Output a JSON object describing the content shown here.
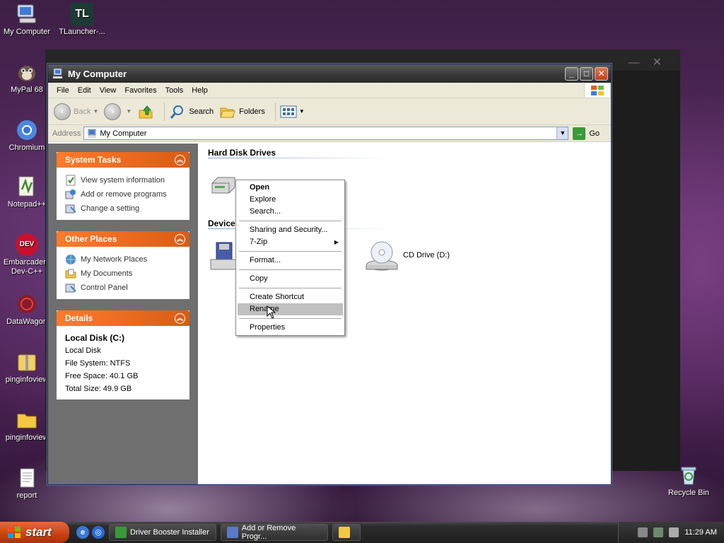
{
  "desktop": {
    "icons": [
      {
        "label": "My Computer"
      },
      {
        "label": "TLauncher-..."
      },
      {
        "label": "MyPal 68"
      },
      {
        "label": "Chromium"
      },
      {
        "label": "Notepad++"
      },
      {
        "label": "Embarcadero Dev-C++"
      },
      {
        "label": "DataWagon"
      },
      {
        "label": "pinginfoview"
      },
      {
        "label": "pinginfoview"
      },
      {
        "label": "report"
      },
      {
        "label": "Recycle Bin"
      }
    ],
    "tl_glyph": "TL",
    "dev_glyph": "DEV"
  },
  "window": {
    "title": "My Computer",
    "menu": [
      "File",
      "Edit",
      "View",
      "Favorites",
      "Tools",
      "Help"
    ],
    "toolbar": {
      "back": "Back",
      "search": "Search",
      "folders": "Folders"
    },
    "address": {
      "label": "Address",
      "value": "My Computer",
      "go": "Go"
    }
  },
  "sidebar": {
    "system_tasks": {
      "title": "System Tasks",
      "items": [
        "View system information",
        "Add or remove programs",
        "Change a setting"
      ]
    },
    "other_places": {
      "title": "Other Places",
      "items": [
        "My Network Places",
        "My Documents",
        "Control Panel"
      ]
    },
    "details": {
      "title": "Details",
      "name": "Local Disk (C:)",
      "type": "Local Disk",
      "file_system": "File System: NTFS",
      "free_space": "Free Space: 40.1 GB",
      "total_size": "Total Size: 49.9 GB"
    }
  },
  "main": {
    "group_hdd": "Hard Disk Drives",
    "group_removable": "Device",
    "cd_drive": "CD Drive (D:)"
  },
  "context_menu": {
    "items": [
      "Open",
      "Explore",
      "Search...",
      "Sharing and Security...",
      "7-Zip",
      "Format...",
      "Copy",
      "Create Shortcut",
      "Rename",
      "Properties"
    ]
  },
  "taskbar": {
    "start": "start",
    "tasks": [
      "Driver Booster Installer",
      "Add or Remove Progr..."
    ],
    "clock": "11:29 AM"
  },
  "colors": {
    "task_header": "#e8601b",
    "sidebar_bg": "#6f6f6f",
    "start_button": "#c83f12"
  }
}
